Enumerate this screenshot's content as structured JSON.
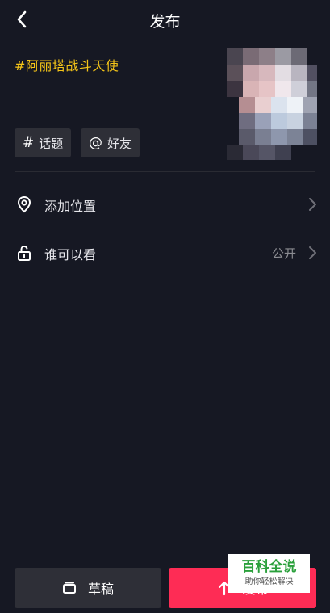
{
  "header": {
    "title": "发布"
  },
  "post": {
    "caption": "#阿丽塔战斗天使",
    "topic_label": "话题",
    "friends_label": "好友"
  },
  "options": [
    {
      "label": "添加位置",
      "value": ""
    },
    {
      "label": "谁可以看",
      "value": "公开"
    }
  ],
  "footer": {
    "draft_label": "草稿",
    "publish_label": "发布"
  },
  "watermark": {
    "title": "百科全说",
    "subtitle": "助你轻松解决"
  },
  "colors": {
    "background": "#161823",
    "accent": "#fe2c55",
    "hashtag": "#f5c518",
    "chip": "#2e2f37"
  }
}
